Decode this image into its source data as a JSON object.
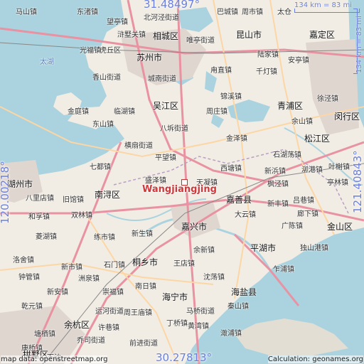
{
  "location": {
    "name": "Wangjiangjing"
  },
  "coords": {
    "top": "31.48497°",
    "bottom": "30.27813°",
    "left": "120.00218°",
    "right": "121.40843°"
  },
  "scale": {
    "top": "134 km = 83 mi",
    "right": "134 km = 83 mi"
  },
  "credits": {
    "left": "map data: openstreetmap.org",
    "right": "Calculation: geonames.org"
  },
  "places": [
    {
      "id": "mashan",
      "label": "马山镇"
    },
    {
      "id": "dongzhu",
      "label": "东渚镇"
    },
    {
      "id": "guangfu",
      "label": "光福镇"
    },
    {
      "id": "xiangshan",
      "label": "香山街道"
    },
    {
      "id": "taihu",
      "label": "太湖"
    },
    {
      "id": "huqiu",
      "label": "虎丘区"
    },
    {
      "id": "suzhou",
      "label": "苏州市"
    },
    {
      "id": "xuguan",
      "label": "浒墅关镇"
    },
    {
      "id": "xiangcheng",
      "label": "相城区"
    },
    {
      "id": "wangting",
      "label": "望亭镇"
    },
    {
      "id": "beiqiao",
      "label": "北河泾街道"
    },
    {
      "id": "bacheng",
      "label": "巴城镇"
    },
    {
      "id": "zhouzhuang_k",
      "label": "周市镇"
    },
    {
      "id": "taicang",
      "label": "太仓"
    },
    {
      "id": "kunshan",
      "label": "昆山市"
    },
    {
      "id": "jiading",
      "label": "嘉定区"
    },
    {
      "id": "loufeng",
      "label": "唯亭街道"
    },
    {
      "id": "luomu",
      "label": "陆家镇"
    },
    {
      "id": "anting",
      "label": "安亭镇"
    },
    {
      "id": "chengnan",
      "label": "城南街道"
    },
    {
      "id": "yongzhi",
      "label": "甪直镇"
    },
    {
      "id": "qiandeng",
      "label": "千灯镇"
    },
    {
      "id": "jinxi",
      "label": "锦溪镇"
    },
    {
      "id": "qingpu",
      "label": "青浦区"
    },
    {
      "id": "xujing",
      "label": "徐泾镇"
    },
    {
      "id": "jinting",
      "label": "金庭镇"
    },
    {
      "id": "linhu",
      "label": "临湖镇"
    },
    {
      "id": "wujiang",
      "label": "吴江区"
    },
    {
      "id": "zhouzhuang",
      "label": "周庄镇"
    },
    {
      "id": "yushan",
      "label": "余山镇"
    },
    {
      "id": "minhang",
      "label": "闵行区"
    },
    {
      "id": "dongshan",
      "label": "东山镇"
    },
    {
      "id": "bachi",
      "label": "八坼街道"
    },
    {
      "id": "jinze",
      "label": "金泽镇"
    },
    {
      "id": "songjiang",
      "label": "松江区"
    },
    {
      "id": "hengshan",
      "label": "横扇街道"
    },
    {
      "id": "pingwang",
      "label": "平望镇"
    },
    {
      "id": "shihu",
      "label": "石湖荡镇"
    },
    {
      "id": "qidu",
      "label": "七都镇"
    },
    {
      "id": "xitang",
      "label": "西塘镇"
    },
    {
      "id": "xinbang",
      "label": "新浜镇"
    },
    {
      "id": "shihuang",
      "label": "泖港镇"
    },
    {
      "id": "yexie",
      "label": "叶榭镇"
    },
    {
      "id": "huzhou",
      "label": "湖州市"
    },
    {
      "id": "shengze",
      "label": "盛泽镇"
    },
    {
      "id": "tianning",
      "label": "天凝镇"
    },
    {
      "id": "nanxun",
      "label": "南浔区"
    },
    {
      "id": "jiashan",
      "label": "嘉善县"
    },
    {
      "id": "fengjing",
      "label": "枫泾镇"
    },
    {
      "id": "lvxiang",
      "label": "吕巷镇"
    },
    {
      "id": "tinglin",
      "label": "亭林镇"
    },
    {
      "id": "balidian",
      "label": "八里店镇"
    },
    {
      "id": "jiuguan",
      "label": "旧馆镇"
    },
    {
      "id": "xinfeng",
      "label": "新丰镇"
    },
    {
      "id": "dayun",
      "label": "大云镇"
    },
    {
      "id": "langxia",
      "label": "廊下镇"
    },
    {
      "id": "hexi",
      "label": "和孚镇"
    },
    {
      "id": "shuanglin",
      "label": "双林镇"
    },
    {
      "id": "jiaxing",
      "label": "嘉兴市"
    },
    {
      "id": "guangchen",
      "label": "广陈镇"
    },
    {
      "id": "jinshan",
      "label": "金山区"
    },
    {
      "id": "linghu",
      "label": "菱湖镇"
    },
    {
      "id": "lianshi",
      "label": "练市镇"
    },
    {
      "id": "xinsheng",
      "label": "新生镇"
    },
    {
      "id": "yuxin",
      "label": "余新镇"
    },
    {
      "id": "pinghu",
      "label": "平湖市"
    },
    {
      "id": "dushangang",
      "label": "独山港镇"
    },
    {
      "id": "luoshe",
      "label": "洛舍镇"
    },
    {
      "id": "xinshi",
      "label": "新市镇"
    },
    {
      "id": "shimen",
      "label": "石门镇"
    },
    {
      "id": "tongxiang",
      "label": "桐乡市"
    },
    {
      "id": "wangdian",
      "label": "王店镇"
    },
    {
      "id": "zhapu",
      "label": "乍浦镇"
    },
    {
      "id": "zhongguan",
      "label": "钟管镇"
    },
    {
      "id": "zhouquan",
      "label": "洲泉镇"
    },
    {
      "id": "shendang",
      "label": "沈荡镇"
    },
    {
      "id": "xinan",
      "label": "新安镇"
    },
    {
      "id": "chongfu",
      "label": "崇福镇"
    },
    {
      "id": "nanri",
      "label": "南日镇"
    },
    {
      "id": "haiyan",
      "label": "海盐县"
    },
    {
      "id": "haining",
      "label": "海宁市"
    },
    {
      "id": "qianyuan",
      "label": "乾元镇"
    },
    {
      "id": "yunhe",
      "label": "运河街道"
    },
    {
      "id": "zhouwang",
      "label": "周王庙镇"
    },
    {
      "id": "malu",
      "label": "马桥街道"
    },
    {
      "id": "qinshan",
      "label": "秦山镇"
    },
    {
      "id": "yuhang",
      "label": "余杭区"
    },
    {
      "id": "xuxiang",
      "label": "许巷镇"
    },
    {
      "id": "dingqiao",
      "label": "丁桥镇"
    },
    {
      "id": "huanghua",
      "label": "黄湾镇"
    },
    {
      "id": "tangqi",
      "label": "塘栖镇"
    },
    {
      "id": "qiaosi",
      "label": "乔司街道"
    },
    {
      "id": "qiantang",
      "label": "前进街道"
    },
    {
      "id": "kangqiao",
      "label": "康桥镇"
    },
    {
      "id": "gongshu",
      "label": "拱墅区"
    },
    {
      "id": "xiasha",
      "label": "下沙"
    },
    {
      "id": "cheyang",
      "label": "澉浦镇"
    }
  ]
}
